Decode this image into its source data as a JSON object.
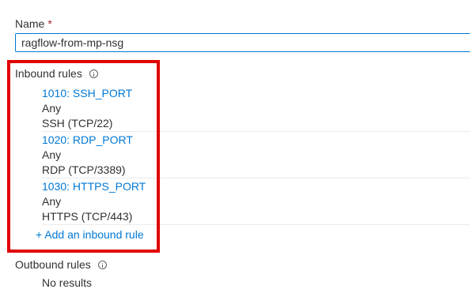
{
  "name_field": {
    "label": "Name",
    "required_marker": "*",
    "value": "ragflow-from-mp-nsg"
  },
  "inbound": {
    "label": "Inbound rules",
    "info_icon": "info-icon",
    "rules": [
      {
        "name": "1010: SSH_PORT",
        "source": "Any",
        "service": "SSH (TCP/22)"
      },
      {
        "name": "1020: RDP_PORT",
        "source": "Any",
        "service": "RDP (TCP/3389)"
      },
      {
        "name": "1030: HTTPS_PORT",
        "source": "Any",
        "service": "HTTPS (TCP/443)"
      }
    ],
    "add_label": "+ Add an inbound rule"
  },
  "outbound": {
    "label": "Outbound rules",
    "info_icon": "info-icon",
    "empty_text": "No results"
  },
  "colors": {
    "link": "#0078d4",
    "highlight": "#e00000",
    "required": "#a4262c"
  }
}
